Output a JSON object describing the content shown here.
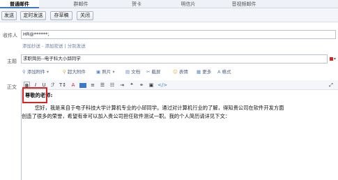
{
  "tabs": [
    {
      "label": "普通邮件",
      "active": true
    },
    {
      "label": "群邮件",
      "active": false
    },
    {
      "label": "贺卡",
      "active": false
    },
    {
      "label": "明信片",
      "active": false
    },
    {
      "label": "音视频邮件",
      "active": false
    }
  ],
  "toolbar": {
    "send": "发送",
    "scheduled_send": "定时发送",
    "save_draft": "存草稿",
    "close": "关闭"
  },
  "form": {
    "recipient_label": "收件人",
    "recipient_value": "HR@******;",
    "cc_links": "添加抄送 - 添加密送 | 分别发送",
    "subject_label": "主题",
    "subject_value": "求职简历--电子科大小邱同学",
    "body_label": "正文"
  },
  "attach_bar": {
    "add_attachment": "添加附件",
    "large_attachment": "超大附件",
    "photo": "照片",
    "document": "文档",
    "screenshot": "截屏",
    "emoji": "表情",
    "more": "更多",
    "format": "格式"
  },
  "format_bar": {
    "bold": "B",
    "italic": "I",
    "underline": "U",
    "font": "A",
    "code": "</>"
  },
  "body": {
    "greeting": "尊敬的老师:",
    "line1": "您好，我是来自于电子科技大学计算机专业的小邱同学。通过对计算机行业的了解，得知贵公司在软件开发方面",
    "line2": "创造了很多的荣誉，希望有幸可以加入贵公司担任软件测试一职。我的个人简历请详见下文："
  },
  "colors": {
    "accent": "#3a78c9",
    "highlight": "#e0201e"
  }
}
